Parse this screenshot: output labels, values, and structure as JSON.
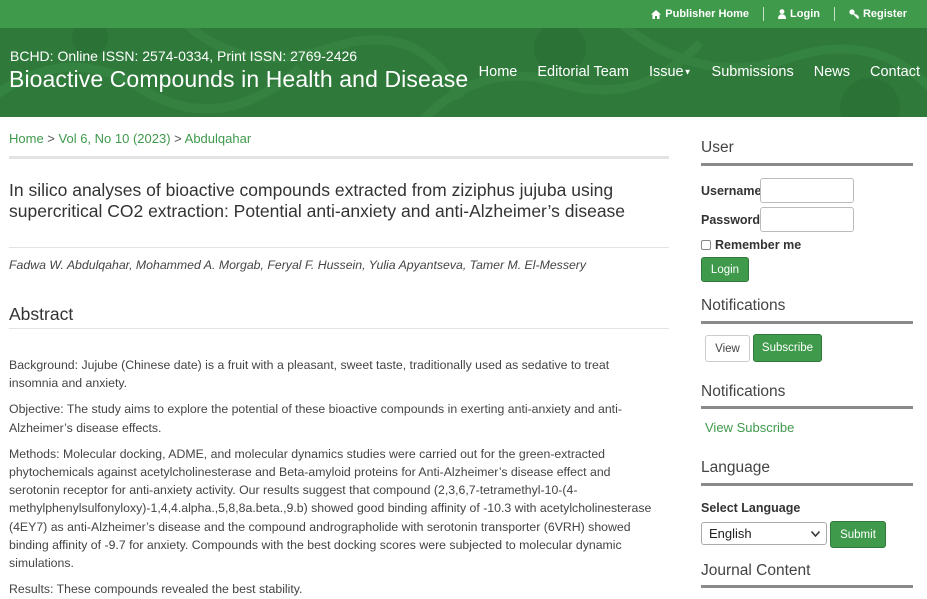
{
  "topbar": {
    "publisher_home": "Publisher Home",
    "login": "Login",
    "register": "Register"
  },
  "header": {
    "issn": "BCHD: Online ISSN: 2574-0334, Print ISSN: 2769-2426",
    "site_title": "Bioactive Compounds in Health and Disease",
    "nav": [
      "Home",
      "Editorial Team",
      "Issue",
      "Submissions",
      "News",
      "Contact"
    ]
  },
  "breadcrumb": {
    "home": "Home",
    "sep1": " > ",
    "issue": "Vol 6, No 10 (2023)",
    "sep2": " > ",
    "current": "Abdulqahar"
  },
  "article": {
    "title": "In silico analyses of bioactive compounds extracted from ziziphus jujuba using supercritical CO2 extraction: Potential anti-anxiety and anti-Alzheimer’s disease",
    "authors": "Fadwa W. Abdulqahar, Mohammed A. Morgab, Feryal F. Hussein, Yulia Apyantseva, Tamer M. El-Messery",
    "abstract_heading": "Abstract",
    "abstract": [
      "Background: Jujube (Chinese date) is a fruit with a pleasant, sweet taste, traditionally used as sedative to treat insomnia and anxiety.",
      "Objective: The study aims to explore the potential of these bioactive compounds in exerting anti-anxiety and anti-Alzheimer’s disease effects.",
      "Methods: Molecular docking, ADME, and molecular dynamics studies were carried out for the green-extracted phytochemicals against acetylcholinesterase and Beta-amyloid proteins for Anti-Alzheimer’s disease effect and serotonin receptor for anti-anxiety activity. Our results suggest that compound (2,3,6,7-tetramethyl-10-(4-methylphenylsulfonyloxy)-1,4,4.alpha.,5,8,8a.beta.,9.b) showed good binding affinity of -10.3 with acetylcholinesterase (4EY7) as anti-Alzheimer’s disease and the compound andrographolide with serotonin transporter (6VRH) showed binding affinity of -9.7 for anxiety. Compounds with the best docking scores were subjected to molecular dynamic simulations.",
      "Results: These compounds revealed the best stability."
    ]
  },
  "sidebar": {
    "user": {
      "title": "User",
      "username_label": "Username",
      "password_label": "Password",
      "remember_label": "Remember me",
      "login_button": "Login"
    },
    "notifications1": {
      "title": "Notifications",
      "view_button": "View",
      "subscribe_button": "Subscribe"
    },
    "notifications2": {
      "title": "Notifications",
      "view_link": "View",
      "subscribe_link": "Subscribe"
    },
    "language": {
      "title": "Language",
      "select_label": "Select Language",
      "selected": "English",
      "submit_button": "Submit"
    },
    "journal_content": {
      "title": "Journal Content"
    }
  },
  "colors": {
    "topbar": "#3f9a4c",
    "header": "#2f7a3b",
    "link": "#3f9a4c",
    "button": "#3f9a4c"
  }
}
